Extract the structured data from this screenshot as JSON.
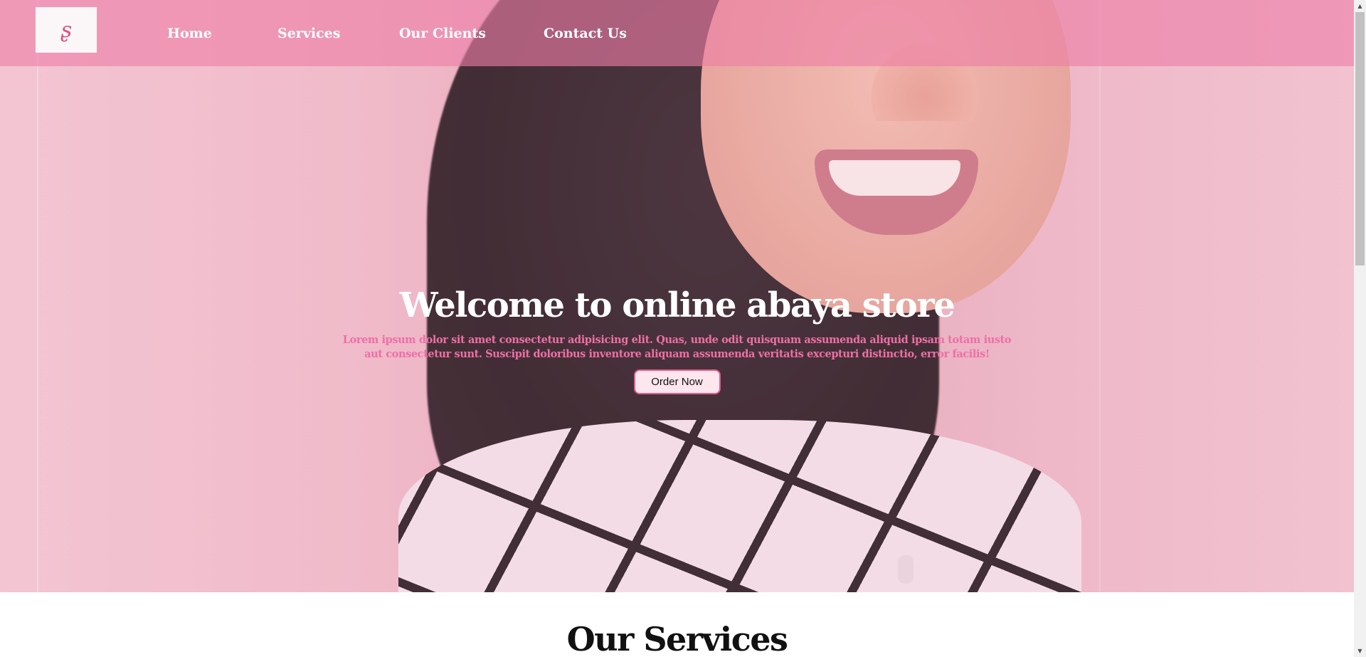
{
  "nav": {
    "logo_icon": "stylized-s-logo",
    "logo_glyph": "ʂ",
    "items": [
      {
        "label": "Home"
      },
      {
        "label": "Services"
      },
      {
        "label": "Our Clients"
      },
      {
        "label": "Contact Us"
      }
    ]
  },
  "hero": {
    "title": "Welcome to online abaya store",
    "text": "Lorem ipsum dolor sit amet consectetur adipisicing elit. Quas, unde odit quisquam assumenda aliquid ipsam totam iusto aut consectetur sunt. Suscipit doloribus inventore aliquam assumenda veritatis excepturi distinctio, error facilis!",
    "cta_label": "Order Now"
  },
  "services": {
    "title": "Our Services"
  },
  "colors": {
    "nav_background": "#ee7ea6",
    "accent_pink": "#ee6fa5",
    "button_border": "#e25d8e",
    "button_background": "#fde6ee"
  },
  "scrollbar": {
    "up_icon": "scroll-up-arrow-icon",
    "down_icon": "scroll-down-arrow-icon"
  }
}
